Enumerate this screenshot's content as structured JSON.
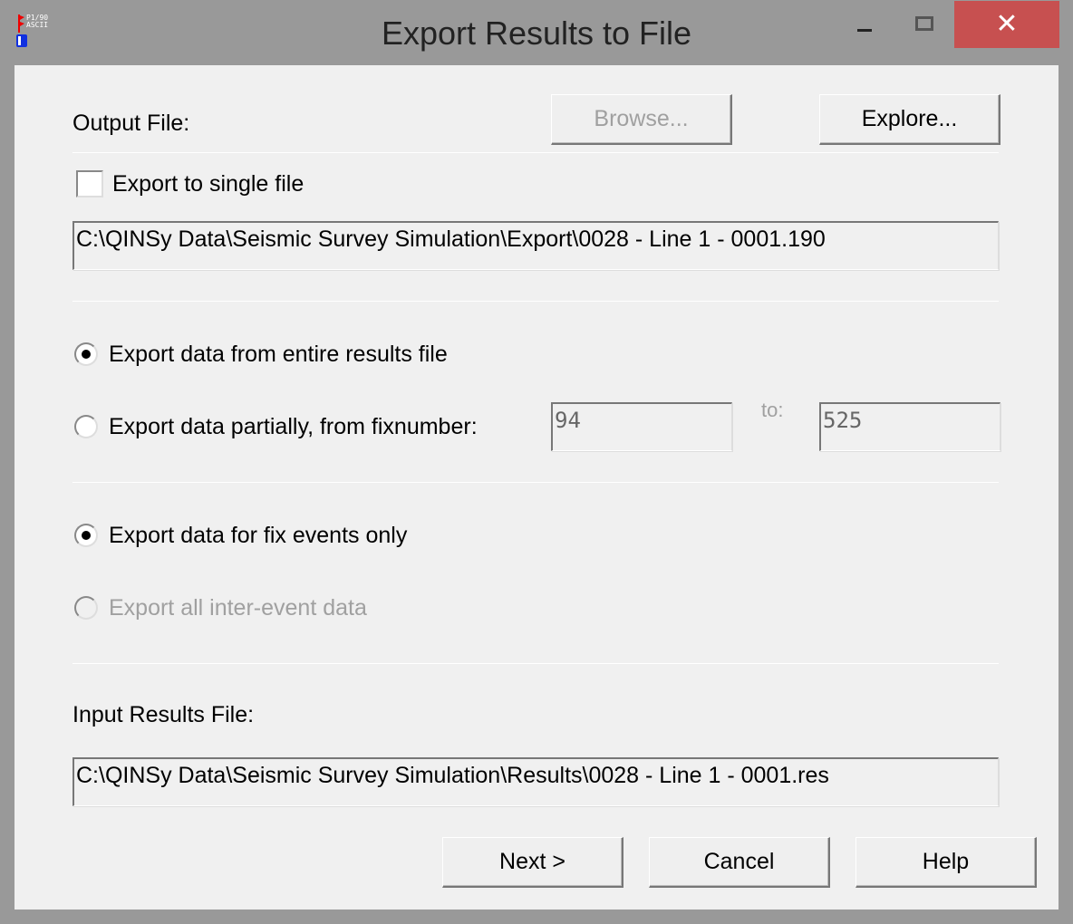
{
  "window": {
    "title": "Export Results to File",
    "icon_text": [
      "P1/90",
      "ASCII"
    ],
    "minimize": "–",
    "close": "✕"
  },
  "output": {
    "label": "Output File:",
    "browse": "Browse...",
    "explore": "Explore...",
    "single_file_label": "Export to single file",
    "single_file_checked": false,
    "path": "C:\\QINSy Data\\Seismic Survey Simulation\\Export\\0028 - Line 1 - 0001.190"
  },
  "range": {
    "entire_label": "Export data from entire results file",
    "entire_selected": true,
    "partial_label": "Export data partially, from fixnumber:",
    "from": "94",
    "to_label": "to:",
    "to": "525"
  },
  "events": {
    "fix_only_label": "Export data for fix events only",
    "fix_only_selected": true,
    "all_label": "Export all inter-event data"
  },
  "input": {
    "label": "Input Results File:",
    "path": "C:\\QINSy Data\\Seismic Survey Simulation\\Results\\0028 - Line 1 - 0001.res"
  },
  "buttons": {
    "next": "Next >",
    "cancel": "Cancel",
    "help": "Help"
  }
}
